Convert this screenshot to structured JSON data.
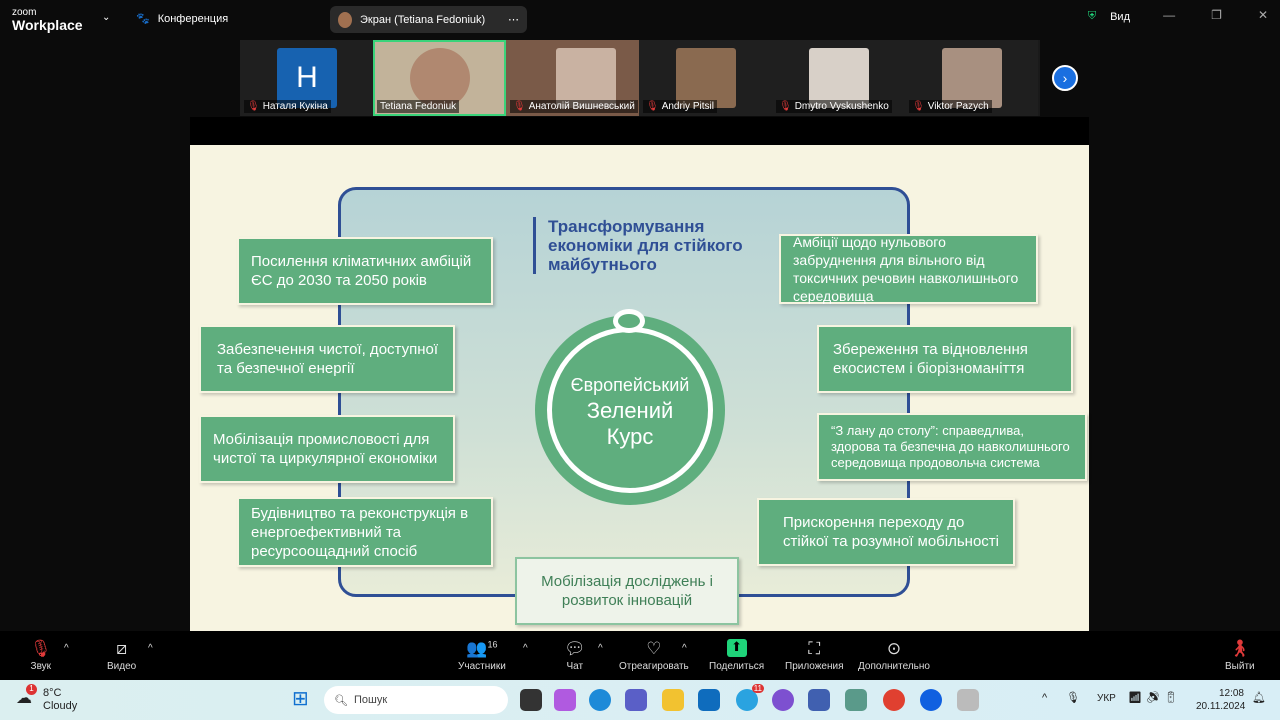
{
  "app": {
    "logo_small": "zoom",
    "logo_big": "Workplace",
    "meeting_label": "Конференция",
    "screen_share_label": "Экран (Tetiana Fedoniuk)",
    "view_label": "Вид"
  },
  "participants": [
    {
      "name": "Наталя Кукіна",
      "initial": "H",
      "muted": true
    },
    {
      "name": "Tetiana Fedoniuk",
      "muted": false,
      "active": true
    },
    {
      "name": "Анатолій Вишневський",
      "muted": true
    },
    {
      "name": "Andriy Pitsil",
      "muted": true
    },
    {
      "name": "Dmytro Vyskushenko",
      "muted": true
    },
    {
      "name": "Viktor Pazych",
      "muted": true
    }
  ],
  "slide": {
    "title": "Трансформування економіки для стійкого майбутнього",
    "center": [
      "Європейський",
      "Зелений",
      "Курс"
    ],
    "left": [
      "Посилення кліматичних амбіцій ЄС до 2030 та 2050 років",
      "Забезпечення чистої, доступної та безпечної енергії",
      "Мобілізація промисловості для чистої та циркулярної економіки",
      "Будівництво та реконструкція в енергоефективний та ресурсоощадний спосіб"
    ],
    "right": [
      "Амбіції щодо нульового забруднення для вільного від токсичних речовин  навколишнього середовища",
      "Збереження та відновлення екосистем і біорізноманіття",
      "“З лану до столу”: справедлива, здорова та безпечна до навколишнього середовища продовольча система",
      "Прискорення переходу до стійкої та розумної мобільності"
    ],
    "bottom": "Мобілізація досліджень і розвиток інновацій"
  },
  "toolbar": {
    "audio": "Звук",
    "video": "Видео",
    "participants": "Участники",
    "participants_count": "16",
    "chat": "Чат",
    "react": "Отреагировать",
    "share": "Поделиться",
    "apps": "Приложения",
    "more": "Дополнительно",
    "leave": "Выйти"
  },
  "taskbar": {
    "temp": "8°C",
    "weather": "Cloudy",
    "weather_badge": "1",
    "search_placeholder": "Пошук",
    "telegram_badge": "11",
    "lang": "УКР",
    "time": "12:08",
    "date": "20.11.2024"
  },
  "colors": {
    "accent_green": "#5fae7e",
    "frame_blue": "#2f4f95",
    "active_speaker": "#3ad37a",
    "share_green": "#1fd47a"
  }
}
